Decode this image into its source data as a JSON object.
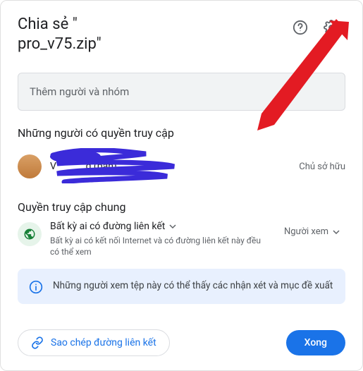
{
  "header": {
    "title_prefix": "Chia sẻ \"",
    "filename": "pro_v75.zip",
    "title_suffix": "\""
  },
  "input": {
    "placeholder": "Thêm người và nhóm"
  },
  "people": {
    "section_title": "Những người có quyền truy cập",
    "owner": {
      "name_prefix": "V",
      "name_suffix": "g (bạn)",
      "role": "Chủ sở hữu"
    }
  },
  "general": {
    "section_title": "Quyền truy cập chung",
    "anyone_label": "Bất kỳ ai có đường liên kết",
    "anyone_desc": "Bất kỳ ai có kết nối Internet và có đường liên kết này đều có thể xem",
    "role_label": "Người xem"
  },
  "info_banner": "Những người xem tệp này có thể thấy các nhận xét và mục đề xuất",
  "footer": {
    "copy_link": "Sao chép đường liên kết",
    "done": "Xong"
  },
  "icons": {
    "help": "help-icon",
    "settings": "gear-icon",
    "globe": "globe-icon",
    "info": "info-icon",
    "link": "link-icon",
    "caret": "caret-down-icon"
  },
  "colors": {
    "primary": "#1a73e8",
    "scribble": "#3b2bd9",
    "arrow": "#e31b23"
  }
}
